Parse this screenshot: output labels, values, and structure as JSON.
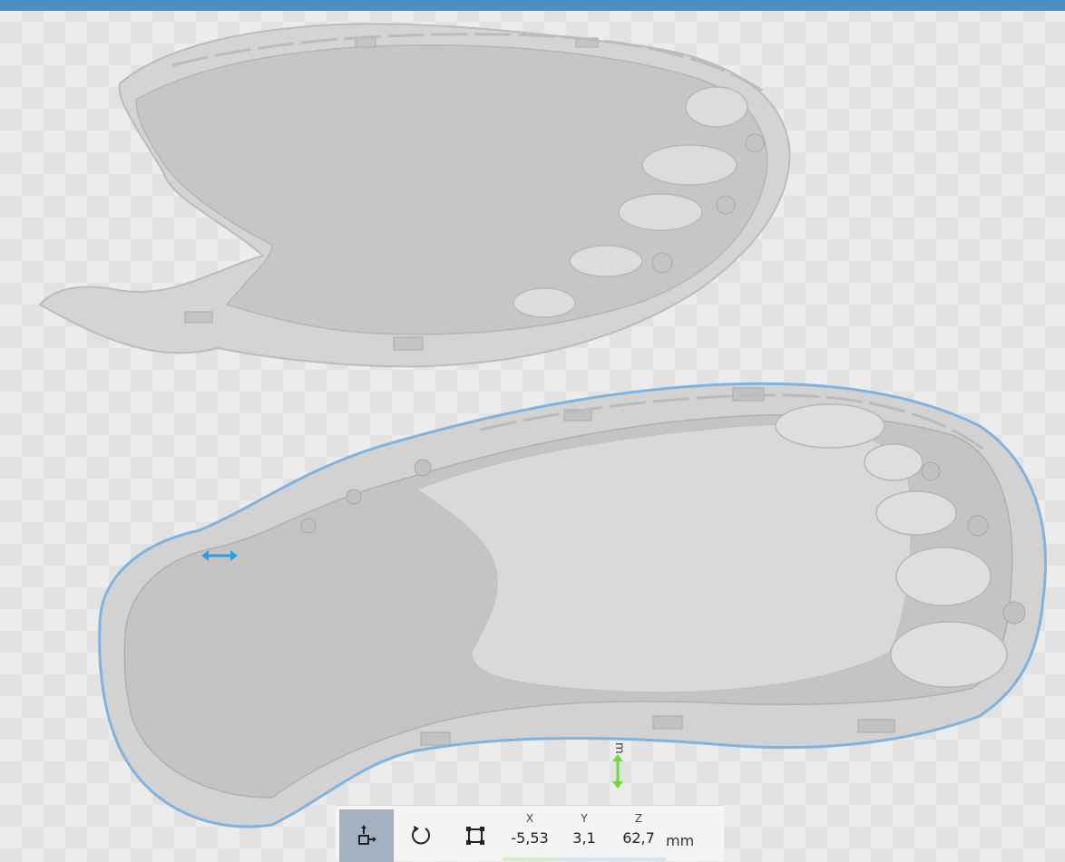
{
  "viewport": {
    "axis_label": "m",
    "colors": {
      "model": "#cdcdcd",
      "selection_outline": "#7fb3e0",
      "x_handle": "#2f9be0",
      "z_handle": "#6ddb3c",
      "header": "#4a90c8"
    }
  },
  "toolbar": {
    "tools": [
      {
        "name": "move-tool",
        "icon": "move-icon",
        "active": true
      },
      {
        "name": "rotate-tool",
        "icon": "rotate-icon",
        "active": false
      },
      {
        "name": "scale-tool",
        "icon": "scale-icon",
        "active": false
      }
    ],
    "coords": {
      "x": {
        "label": "X",
        "value": "-5,53"
      },
      "y": {
        "label": "Y",
        "value": "3,1"
      },
      "z": {
        "label": "Z",
        "value": "62,7"
      }
    },
    "unit": "mm"
  }
}
